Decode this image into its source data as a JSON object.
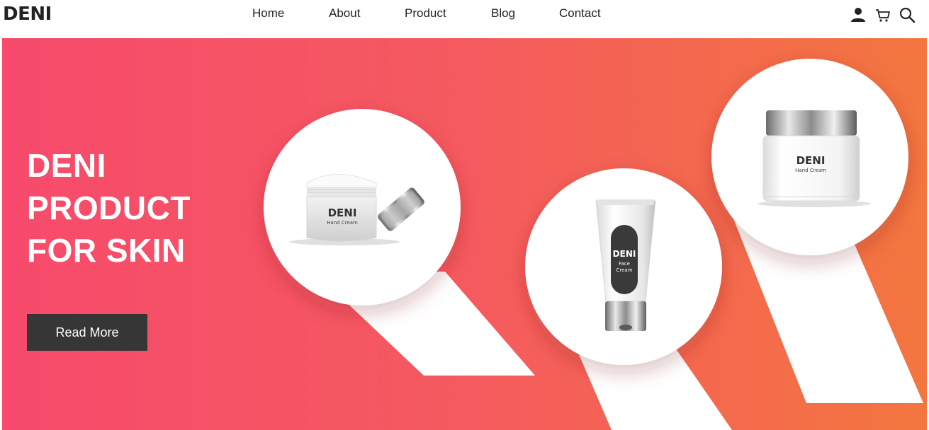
{
  "header": {
    "logo": "DENI",
    "nav": [
      {
        "label": "Home"
      },
      {
        "label": "About"
      },
      {
        "label": "Product"
      },
      {
        "label": "Blog"
      },
      {
        "label": "Contact"
      }
    ],
    "icons": [
      "user-icon",
      "cart-icon",
      "search-icon"
    ]
  },
  "hero": {
    "title_lines": [
      "DENI",
      "PRODUCT",
      "FOR SKIN"
    ],
    "button_label": "Read More",
    "gradient": [
      "#f74a6c",
      "#f55a5f",
      "#f3763f"
    ]
  },
  "products": [
    {
      "brand": "DENI",
      "name": "Hand Cream"
    },
    {
      "brand": "DENI",
      "name_lines": [
        "Face",
        "Cream"
      ]
    },
    {
      "brand": "DENI",
      "name": "Hand Cream"
    }
  ],
  "colors": {
    "button": "#363636",
    "text_dark": "#222222"
  }
}
